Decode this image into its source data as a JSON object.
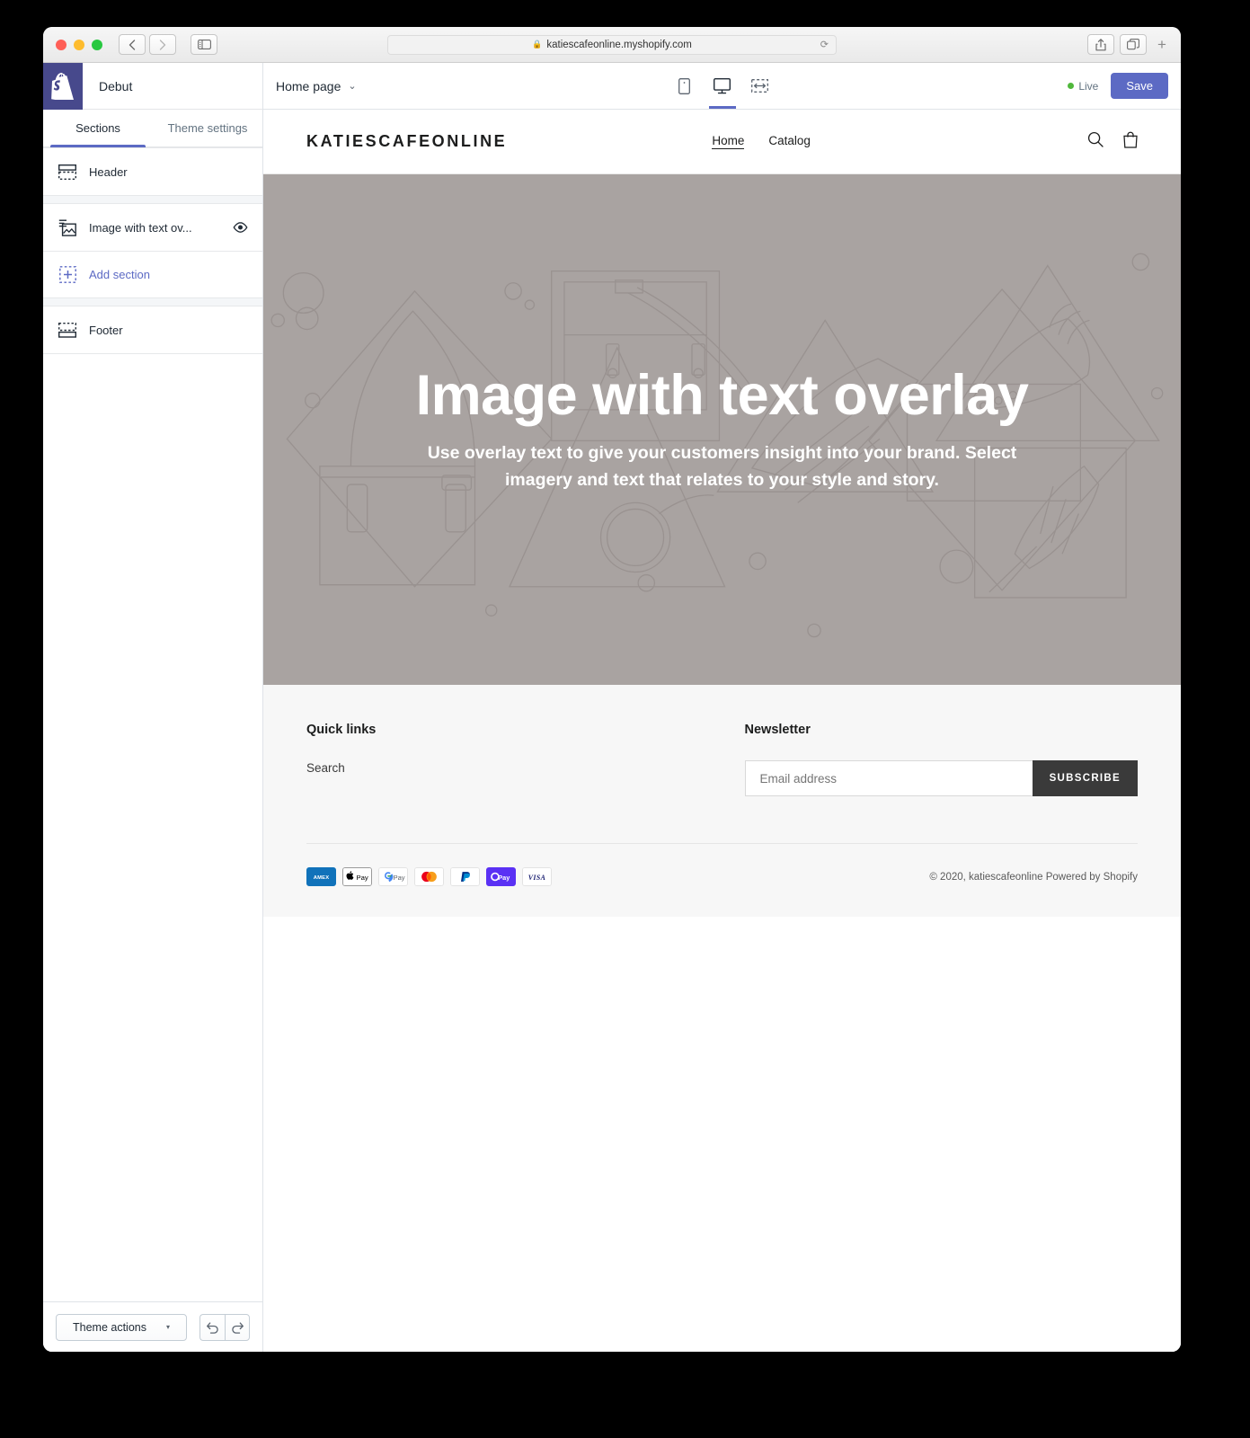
{
  "browser": {
    "url": "katiescafeonline.myshopify.com",
    "lock_icon": "lock-icon",
    "reload_icon": "reload-icon",
    "back_icon": "chevron-left-icon",
    "forward_icon": "chevron-right-icon",
    "sidebar_icon": "sidebar-toggle-icon",
    "share_icon": "share-icon",
    "tabs_icon": "show-tabs-icon",
    "new_tab_label": "+"
  },
  "editor": {
    "theme_name": "Debut",
    "logo_icon": "shopify-logo-icon",
    "tabs": [
      {
        "label": "Sections",
        "active": true
      },
      {
        "label": "Theme settings",
        "active": false
      }
    ],
    "sections": [
      {
        "label": "Header",
        "icon": "header-section-icon",
        "eye": false,
        "type": "section"
      },
      {
        "label": "Image with text ov...",
        "icon": "image-with-text-icon",
        "eye": true,
        "type": "section"
      },
      {
        "label": "Add section",
        "icon": "add-section-icon",
        "eye": false,
        "type": "add"
      },
      {
        "label": "Footer",
        "icon": "footer-section-icon",
        "eye": false,
        "type": "section"
      }
    ],
    "footer": {
      "theme_actions_label": "Theme actions",
      "caret": "▾",
      "undo_icon": "undo-icon",
      "redo_icon": "redo-icon"
    },
    "topbar": {
      "page_label": "Home page",
      "page_caret": "⌄",
      "devices": [
        {
          "name": "mobile",
          "icon": "mobile-icon",
          "active": false
        },
        {
          "name": "desktop",
          "icon": "desktop-icon",
          "active": true
        },
        {
          "name": "fullwidth",
          "icon": "full-width-icon",
          "active": false
        }
      ],
      "live_label": "Live",
      "save_label": "Save",
      "accent_color": "#5c6ac4",
      "live_color": "#50b83c"
    }
  },
  "storefront": {
    "logo": "KATIESCAFEONLINE",
    "nav": [
      {
        "label": "Home",
        "current": true
      },
      {
        "label": "Catalog",
        "current": false
      }
    ],
    "header_icons": [
      {
        "name": "search-icon"
      },
      {
        "name": "cart-icon"
      }
    ],
    "hero": {
      "title": "Image with text overlay",
      "subtitle": "Use overlay text to give your customers insight into your brand. Select imagery and text that relates to your style and story.",
      "background_color": "#a9a3a1"
    },
    "footer": {
      "quick_links": {
        "heading": "Quick links",
        "links": [
          "Search"
        ]
      },
      "newsletter": {
        "heading": "Newsletter",
        "email_placeholder": "Email address",
        "email_value": "",
        "subscribe_label": "SUBSCRIBE"
      },
      "payment_methods": [
        "American Express",
        "Apple Pay",
        "Google Pay",
        "Mastercard",
        "PayPal",
        "Shop Pay",
        "Visa"
      ],
      "copyright": "© 2020, katiescafeonline",
      "powered_by": "Powered by Shopify"
    }
  }
}
